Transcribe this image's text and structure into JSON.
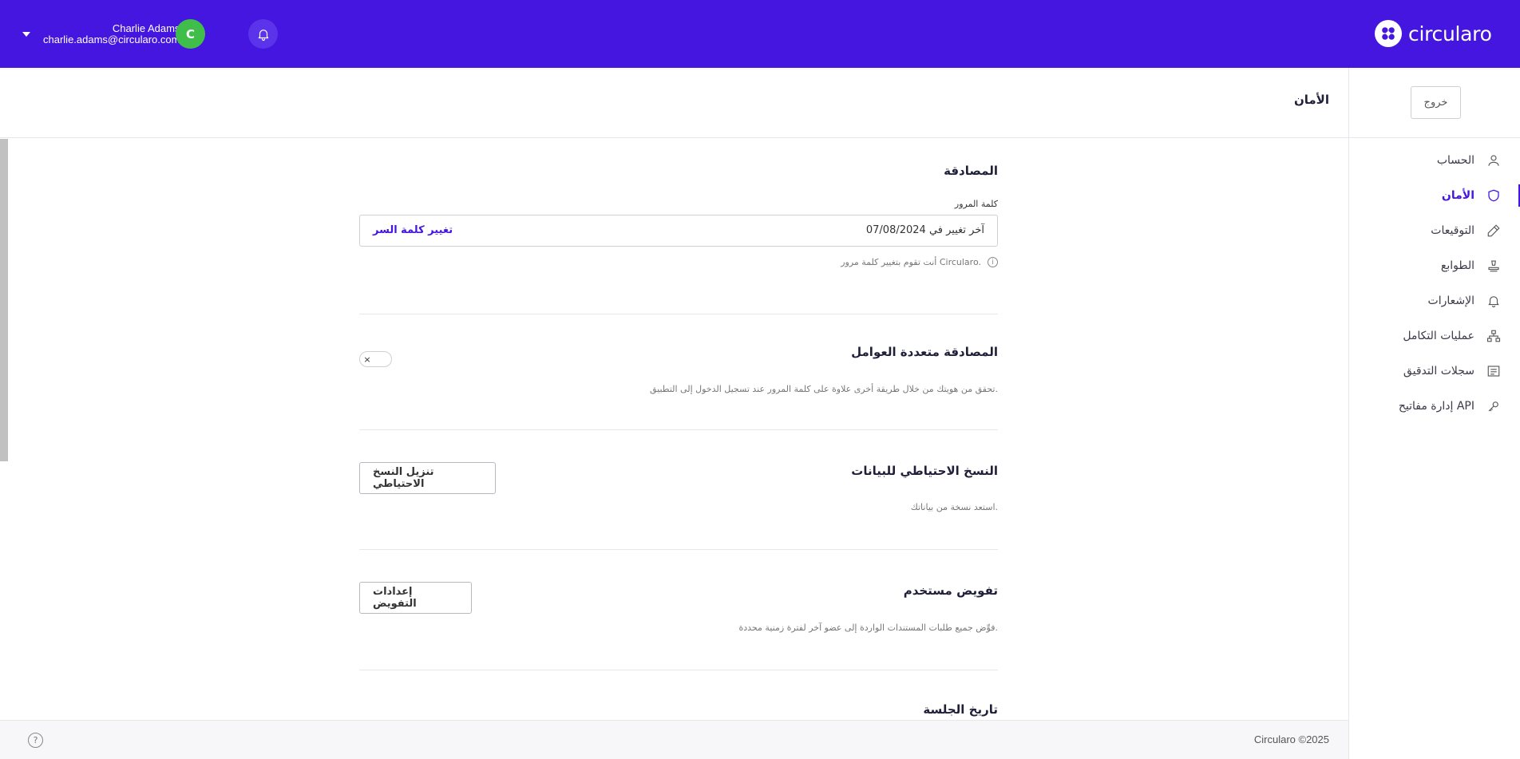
{
  "app": {
    "brand": "circularo"
  },
  "user": {
    "name": "Charlie Adams",
    "email": "charlie.adams@circularo.com",
    "initial": "C"
  },
  "sidebar": {
    "logout_label": "خروج",
    "items": [
      {
        "label": "الحساب",
        "icon": "user-icon",
        "active": false
      },
      {
        "label": "الأمان",
        "icon": "shield-icon",
        "active": true
      },
      {
        "label": "التوقيعات",
        "icon": "pen-icon",
        "active": false
      },
      {
        "label": "الطوابع",
        "icon": "stamp-icon",
        "active": false
      },
      {
        "label": "الإشعارات",
        "icon": "bell-icon",
        "active": false
      },
      {
        "label": "عمليات التكامل",
        "icon": "integrations-icon",
        "active": false
      },
      {
        "label": "سجلات التدقيق",
        "icon": "list-icon",
        "active": false
      },
      {
        "label": "إدارة مفاتيح API",
        "icon": "key-icon",
        "active": false
      }
    ]
  },
  "header": {
    "title": "الأمان"
  },
  "auth": {
    "title": "المصادقة",
    "password_label": "كلمة المرور",
    "last_changed": "آخر تغيير في 07/08/2024",
    "change_link": "تغيير كلمة السر",
    "note": "أنت تقوم بتغيير كلمة مرور Circularo."
  },
  "mfa": {
    "title": "المصادقة متعددة العوامل",
    "description": "تحقق من هويتك من خلال طريقة أخرى علاوة على كلمة المرور عند تسجيل الدخول إلى التطبيق.",
    "enabled": false,
    "toggle_symbol": "×"
  },
  "backup": {
    "title": "النسخ الاحتياطي للبيانات",
    "description": "استعد نسخة من بياناتك.",
    "button_label": "تنزيل النسخ الاحتياطي"
  },
  "delegation": {
    "title": "تفويض مستخدم",
    "description": "فوِّض جميع طلبات المستندات الواردة إلى عضو آخر لفترة زمنية محددة.",
    "button_label": "إعدادات التفويض"
  },
  "session": {
    "title": "تاريخ الجلسة"
  },
  "footer": {
    "copyright": "Circularo ©2025",
    "help_symbol": "?"
  },
  "colors": {
    "brand": "#4416e0",
    "avatar": "#3fbf4a"
  }
}
